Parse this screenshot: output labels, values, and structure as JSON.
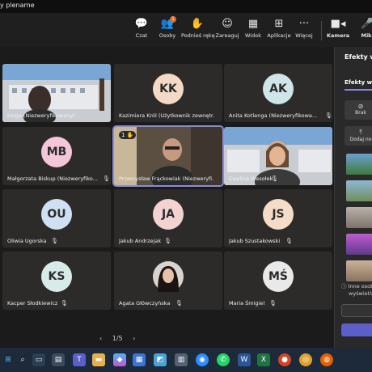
{
  "window": {
    "title": "y plenarne"
  },
  "toolbar": {
    "chat": {
      "label": "Czat",
      "icon": "chat-icon"
    },
    "people": {
      "label": "Osoby",
      "icon": "people-icon",
      "badge": "1"
    },
    "raise_hand": {
      "label": "Podnieś rękę",
      "icon": "hand-icon"
    },
    "react": {
      "label": "Zareaguj",
      "icon": "smile-icon"
    },
    "view": {
      "label": "Widok",
      "icon": "grid-icon"
    },
    "apps": {
      "label": "Aplikacje",
      "icon": "plus-icon"
    },
    "more": {
      "label": "Więcej",
      "icon": "more-icon"
    },
    "camera": {
      "label": "Kamera",
      "icon": "camera-icon"
    },
    "mic": {
      "label": "Mik",
      "icon": "mic-icon"
    }
  },
  "participants": [
    {
      "name": "kinga (Niezweryfikowany)",
      "initials": "",
      "video": true
    },
    {
      "name": "Kazimiera Król (Użytkownik zewnętr...",
      "initials": "KK",
      "color": "#f3d9c6"
    },
    {
      "name": "Anita Kotlenga (Niezweryfikowa...",
      "initials": "AK",
      "color": "#cfe5e8"
    },
    {
      "name": "Małgorzata Biskup (Niezweryfiko...",
      "initials": "MB",
      "color": "#f3c6d8"
    },
    {
      "name": "Przemysław Frąckowiak (Niezweryfi...",
      "initials": "",
      "video": true,
      "hand": "1"
    },
    {
      "name": "Ewelina Wesołek",
      "initials": "",
      "video": true
    },
    {
      "name": "Oliwia Ugorska",
      "initials": "OU",
      "color": "#cfe0f5"
    },
    {
      "name": "Jakub Andrzejak",
      "initials": "JA",
      "color": "#f3d2d2"
    },
    {
      "name": "Jakub Szustakowski",
      "initials": "JS",
      "color": "#f5dcc9"
    },
    {
      "name": "Kacper Słodkiewicz",
      "initials": "KS",
      "color": "#d7ece9"
    },
    {
      "name": "Agata Główczyńska",
      "initials": "",
      "photo": true
    },
    {
      "name": "Maria Śmigiel",
      "initials": "MŚ",
      "color": "#e9e9e9"
    }
  ],
  "pager": {
    "text": "1/5",
    "prev": "‹",
    "next": "›"
  },
  "panel": {
    "title": "Efekty w",
    "subtitle": "Efekty wi",
    "none_label": "Brak",
    "add_label": "Dodaj no",
    "info_line1": "Inne osob",
    "info_line2": "wyświetla"
  },
  "taskbar": {
    "icons": [
      "windows-icon",
      "search-icon",
      "taskview-icon",
      "widgets-icon",
      "teams-icon",
      "explorer-icon",
      "copilot-icon",
      "store-icon",
      "photos-icon",
      "calculator-icon",
      "zoom-icon",
      "whatsapp-icon",
      "word-icon",
      "excel-icon",
      "chrome-icon",
      "chrome-alt-icon",
      "firefox-icon"
    ]
  }
}
